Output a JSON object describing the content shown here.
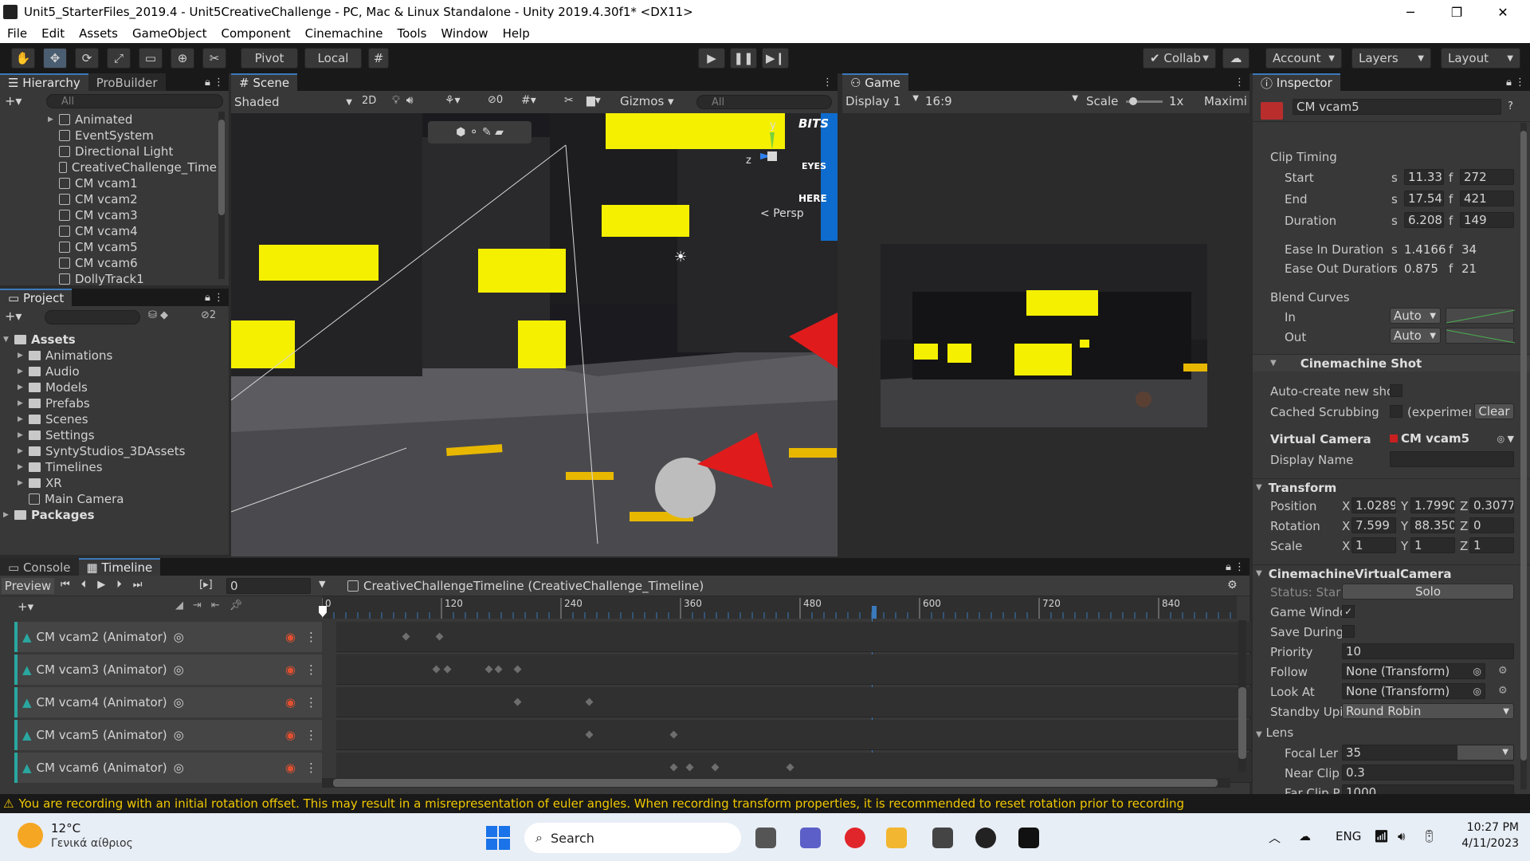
{
  "window": {
    "title": "Unit5_StarterFiles_2019.4 - Unit5CreativeChallenge - PC, Mac & Linux Standalone - Unity 2019.4.30f1* <DX11>",
    "minimize": "─",
    "maximize": "❐",
    "close": "✕"
  },
  "menu": [
    "File",
    "Edit",
    "Assets",
    "GameObject",
    "Component",
    "Cinemachine",
    "Tools",
    "Window",
    "Help"
  ],
  "toolbar": {
    "pivot": "Pivot",
    "local": "Local",
    "collab": "Collab",
    "account": "Account",
    "layers": "Layers",
    "layout": "Layout"
  },
  "hierarchy": {
    "tab": "Hierarchy",
    "tab2": "ProBuilder",
    "search_placeholder": "All",
    "items": [
      "Animated",
      "EventSystem",
      "Directional Light",
      "CreativeChallenge_Time",
      "CM vcam1",
      "CM vcam2",
      "CM vcam3",
      "CM vcam4",
      "CM vcam5",
      "CM vcam6",
      "DollyTrack1"
    ]
  },
  "project": {
    "tab": "Project",
    "hidden_count": "2",
    "items": [
      {
        "label": "Assets",
        "bold": true,
        "indent": 0
      },
      {
        "label": "Animations",
        "indent": 1
      },
      {
        "label": "Audio",
        "indent": 1
      },
      {
        "label": "Models",
        "indent": 1
      },
      {
        "label": "Prefabs",
        "indent": 1
      },
      {
        "label": "Scenes",
        "indent": 1
      },
      {
        "label": "Settings",
        "indent": 1
      },
      {
        "label": "SyntyStudios_3DAssets",
        "indent": 1
      },
      {
        "label": "Timelines",
        "indent": 1
      },
      {
        "label": "XR",
        "indent": 1
      },
      {
        "label": "Main Camera",
        "indent": 1,
        "camera": true
      },
      {
        "label": "Packages",
        "bold": true,
        "indent": 0
      }
    ]
  },
  "scene": {
    "tab": "Scene",
    "shading": "Shaded",
    "mode2d": "2D",
    "hidden": "0",
    "gizmos": "Gizmos",
    "search_placeholder": "All",
    "persp": "Persp",
    "axis_y": "y",
    "axis_z": "z",
    "sign": "BITS",
    "sign2": "EYES",
    "sign3": "HERE"
  },
  "game": {
    "tab": "Game",
    "display": "Display 1",
    "aspect": "16:9",
    "scale_label": "Scale",
    "scale_value": "1x",
    "maximize": "Maximi"
  },
  "inspector": {
    "tab": "Inspector",
    "name": "CM vcam5",
    "clip_timing": "Clip Timing",
    "start": {
      "label": "Start",
      "s": "11.333",
      "f": "272"
    },
    "end": {
      "label": "End",
      "s": "17.541",
      "f": "421"
    },
    "duration": {
      "label": "Duration",
      "s": "6.2083",
      "f": "149"
    },
    "ease_in": {
      "label": "Ease In Duration",
      "s": "1.41666",
      "f": "34"
    },
    "ease_out": {
      "label": "Ease Out Duration",
      "s": "0.875",
      "f": "21"
    },
    "blend_curves": "Blend Curves",
    "in_label": "In",
    "out_label": "Out",
    "in_value": "Auto",
    "out_value": "Auto",
    "cinemachine_shot": "Cinemachine Shot",
    "auto_create": "Auto-create new sho",
    "cached_scrubbing": "Cached Scrubbing",
    "experimental": "(experimen",
    "clear": "Clear",
    "virtual_camera": "Virtual Camera",
    "vcam_value": "CM vcam5",
    "display_name": "Display Name",
    "transform": "Transform",
    "position": "Position",
    "rotation": "Rotation",
    "scale": "Scale",
    "pos": {
      "x": "1.0289",
      "y": "1.7990",
      "z": "0.3077"
    },
    "rot": {
      "x": "7.599",
      "y": "88.350",
      "z": "0"
    },
    "scl": {
      "x": "1",
      "y": "1",
      "z": "1"
    },
    "cvc": "CinemachineVirtualCamera",
    "status": "Status: Star",
    "solo": "Solo",
    "game_window": "Game Windo",
    "save_during": "Save During",
    "priority": "Priority",
    "priority_value": "10",
    "follow": "Follow",
    "follow_value": "None (Transform)",
    "look_at": "Look At",
    "look_at_value": "None (Transform)",
    "standby": "Standby Upi",
    "standby_value": "Round Robin",
    "lens": "Lens",
    "focal": "Focal Ler",
    "focal_value": "35",
    "near": "Near Clip",
    "near_value": "0.3",
    "far": "Far Clip P",
    "far_value": "1000"
  },
  "timeline": {
    "tab_console": "Console",
    "tab_timeline": "Timeline",
    "preview": "Preview",
    "frame": "0",
    "asset": "CreativeChallengeTimeline (CreativeChallenge_Timeline)",
    "ruler": [
      "0",
      "120",
      "240",
      "360",
      "480",
      "600",
      "720",
      "840"
    ],
    "tracks": [
      "CM vcam2 (Animator)",
      "CM vcam3 (Animator)",
      "CM vcam4 (Animator)",
      "CM vcam5 (Animator)",
      "CM vcam6 (Animator)"
    ]
  },
  "status_bar": "You are recording with an initial rotation offset. This may result in a misrepresentation of euler angles. When recording transform properties, it is recommended to reset rotation prior to recording",
  "taskbar": {
    "temp": "12°C",
    "weather": "Γενικά αίθριος",
    "search": "Search",
    "lang": "ENG",
    "time": "10:27 PM",
    "date": "4/11/2023"
  },
  "colors": {
    "accent": "#3a79bb",
    "window_yellow": "#f5f000",
    "warning": "#f0c800"
  }
}
